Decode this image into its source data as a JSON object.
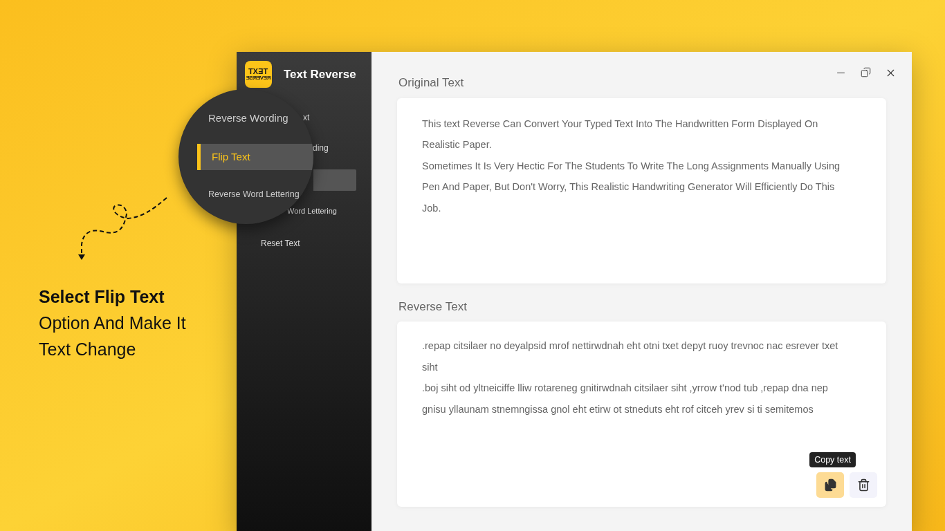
{
  "promo": {
    "lines": [
      "Select Flip Text",
      "Option And Make It",
      "Text Change"
    ]
  },
  "app": {
    "logo": {
      "top": "TEXT",
      "bottom": "REVERSE"
    },
    "title": "Text Reverse",
    "sidebar_items": [
      {
        "label": "xt",
        "selected": false
      },
      {
        "label": "ding",
        "selected": false
      },
      {
        "selected": true
      },
      {
        "label": "Word Lettering",
        "selected": false
      },
      {
        "label": "Reset Text",
        "selected": false
      }
    ],
    "magnifier_items": [
      {
        "label": "Reverse Wording",
        "selected": false
      },
      {
        "label": "Flip Text",
        "selected": true
      },
      {
        "label": "Reverse Word Lettering",
        "selected": false
      }
    ],
    "original": {
      "label": "Original Text",
      "paragraphs": [
        "This text Reverse Can Convert Your Typed Text Into The Handwritten Form Displayed On Realistic Paper.",
        "Sometimes It Is Very Hectic For The Students To Write The Long Assignments Manually Using Pen And Paper, But Don't Worry, This Realistic Handwriting Generator Will Efficiently Do This Job."
      ]
    },
    "reverse": {
      "label": "Reverse Text",
      "paragraphs": [
        ".repap citsilaer no deyalpsid mrof nettirwdnah eht otni txet depyt ruoy trevnoc nac esrever txet siht",
        ".boj siht od yltneiciffe lliw rotareneg gnitirwdnah citsilaer siht ,yrrow t'nod tub ,repap dna nep gnisu yllaunam stnemngissa gnol eht etirw ot stneduts eht rof citceh yrev si ti semitemos"
      ],
      "tooltip": "Copy text"
    }
  }
}
